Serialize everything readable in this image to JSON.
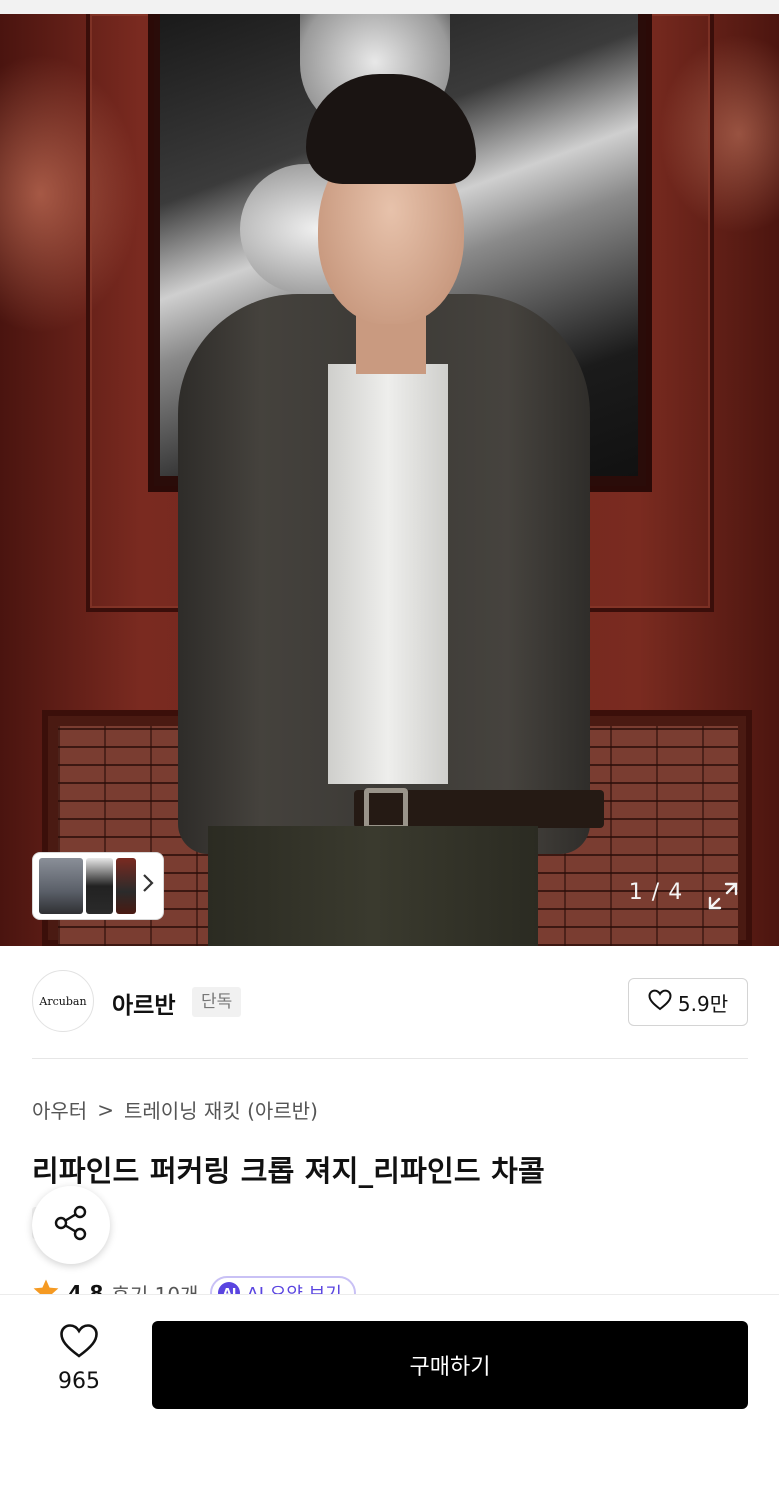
{
  "gallery": {
    "page_counter": "1 / 4",
    "current_index": 1,
    "total": 4
  },
  "brand": {
    "logo_text": "Arcuban",
    "name": "아르반",
    "badge": "단독",
    "likes": "5.9만"
  },
  "breadcrumb": {
    "items": [
      "아우터",
      "트레이닝 재킷 (아르반)"
    ],
    "separator": ">"
  },
  "product": {
    "title": "리파인드 퍼커링 크롭 져지_리파인드 차콜",
    "exclusive_badge": "단독"
  },
  "rating": {
    "score": "4.8",
    "reviews": "후기 10개",
    "ai_mark": "AI",
    "ai_summary": "AI 요약 보기"
  },
  "bottom_bar": {
    "wish_count": "965",
    "buy_label": "구매하기"
  },
  "icons": {
    "heart": "heart-icon",
    "share": "share-icon",
    "expand": "expand-icon",
    "chevron": "chevron-right-icon",
    "star": "star-icon"
  },
  "colors": {
    "accent_black": "#000000",
    "star": "#f59a23",
    "ai_purple": "#5a45e0",
    "badge_bg": "#f1f1f1"
  }
}
